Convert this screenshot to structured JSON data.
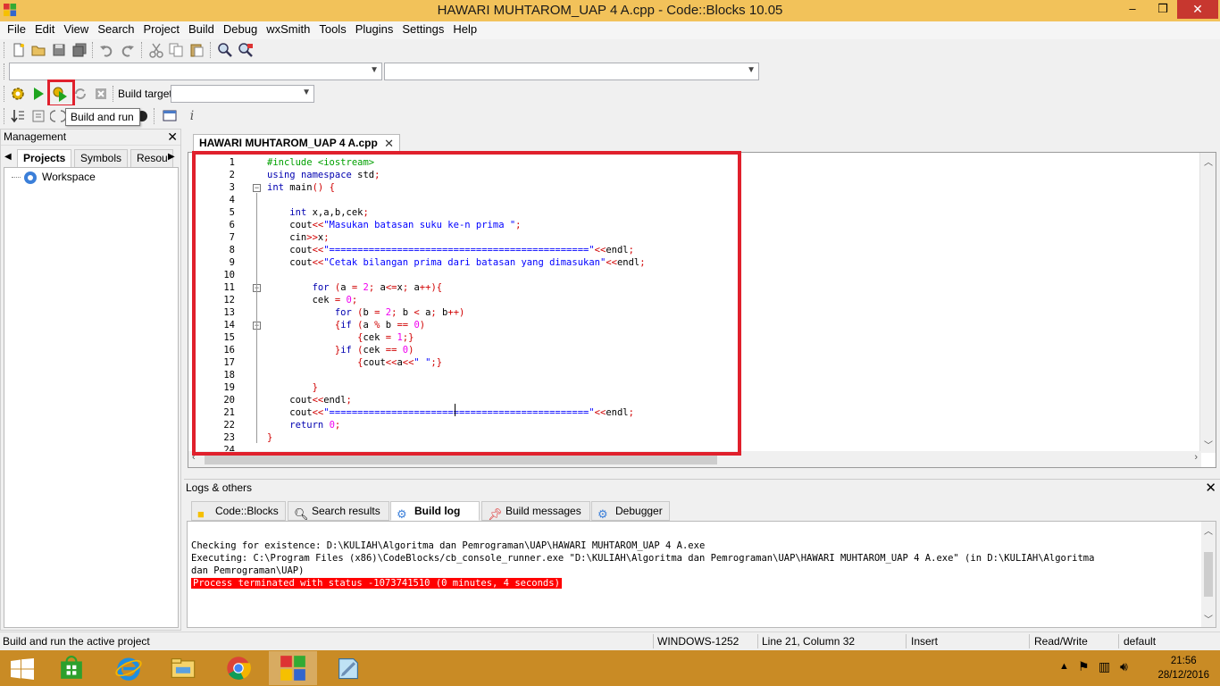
{
  "window": {
    "title": "HAWARI MUHTAROM_UAP 4 A.cpp - Code::Blocks 10.05",
    "minimize": "–",
    "maximize": "❒",
    "close": "✕"
  },
  "menubar": [
    "File",
    "Edit",
    "View",
    "Search",
    "Project",
    "Build",
    "Debug",
    "wxSmith",
    "Tools",
    "Plugins",
    "Settings",
    "Help"
  ],
  "toolbar": {
    "build_target_label": "Build target:",
    "build_target_value": "",
    "tooltip": "Build and run",
    "icons": [
      "new-file-icon",
      "open-icon",
      "save-icon",
      "save-all-icon",
      "undo-icon",
      "redo-icon",
      "cut-icon",
      "copy-icon",
      "paste-icon",
      "find-icon",
      "replace-icon"
    ]
  },
  "management": {
    "title": "Management",
    "tabs": [
      "Projects",
      "Symbols",
      "Resou"
    ],
    "tree": [
      {
        "label": "Workspace"
      }
    ]
  },
  "editor": {
    "tab_title": "HAWARI MUHTAROM_UAP 4 A.cpp",
    "lines": [
      {
        "n": "1",
        "t": "#include <iostream>"
      },
      {
        "n": "2",
        "t": "using namespace std;"
      },
      {
        "n": "3",
        "t": "int main() {"
      },
      {
        "n": "4",
        "t": ""
      },
      {
        "n": "5",
        "t": "    int x,a,b,cek;"
      },
      {
        "n": "6",
        "t": "    cout<<\"Masukan batasan suku ke-n prima \";"
      },
      {
        "n": "7",
        "t": "    cin>>x;"
      },
      {
        "n": "8",
        "t": "    cout<<\"==============================================\"<<endl;"
      },
      {
        "n": "9",
        "t": "    cout<<\"Cetak bilangan prima dari batasan yang dimasukan\"<<endl;"
      },
      {
        "n": "10",
        "t": ""
      },
      {
        "n": "11",
        "t": "        for (a = 2; a<=x; a++){"
      },
      {
        "n": "12",
        "t": "        cek = 0;"
      },
      {
        "n": "13",
        "t": "            for (b = 2; b < a; b++)"
      },
      {
        "n": "14",
        "t": "            {if (a % b == 0)"
      },
      {
        "n": "15",
        "t": "                {cek = 1;}"
      },
      {
        "n": "16",
        "t": "            }if (cek == 0)"
      },
      {
        "n": "17",
        "t": "                {cout<<a<<\" \";}"
      },
      {
        "n": "18",
        "t": ""
      },
      {
        "n": "19",
        "t": "        }"
      },
      {
        "n": "20",
        "t": "    cout<<endl;"
      },
      {
        "n": "21",
        "t": "    cout<<\"==============================================\"<<endl;"
      },
      {
        "n": "22",
        "t": "    return 0;"
      },
      {
        "n": "23",
        "t": "}"
      },
      {
        "n": "24",
        "t": ""
      }
    ]
  },
  "logs": {
    "title": "Logs & others",
    "tabs": [
      {
        "label": "Code::Blocks",
        "icon": "codeblocks-icon"
      },
      {
        "label": "Search results",
        "icon": "search-icon"
      },
      {
        "label": "Build log",
        "icon": "gear-icon",
        "active": true
      },
      {
        "label": "Build messages",
        "icon": "pin-icon"
      },
      {
        "label": "Debugger",
        "icon": "debugger-icon"
      }
    ],
    "lines": [
      "Checking for existence: D:\\KULIAH\\Algoritma dan Pemrograman\\UAP\\HAWARI MUHTAROM_UAP 4 A.exe",
      "Executing: C:\\Program Files (x86)\\CodeBlocks/cb_console_runner.exe \"D:\\KULIAH\\Algoritma dan Pemrograman\\UAP\\HAWARI MUHTAROM_UAP 4 A.exe\" (in D:\\KULIAH\\Algoritma",
      "dan Pemrograman\\UAP)"
    ],
    "error_line": "Process terminated with status -1073741510 (0 minutes, 4 seconds)"
  },
  "statusbar": {
    "message": "Build and run the active project",
    "encoding": "WINDOWS-1252",
    "position": "Line 21, Column 32",
    "mode": "Insert",
    "access": "Read/Write",
    "profile": "default"
  },
  "taskbar": {
    "time": "21:56",
    "date": "28/12/2016"
  },
  "colors": {
    "titlebar": "#f2c25a",
    "taskbar": "#c98b25",
    "highlight_red": "#e0202c",
    "keyword": "#0000b0",
    "string": "#0000ff",
    "preprocessor": "#00a000"
  }
}
